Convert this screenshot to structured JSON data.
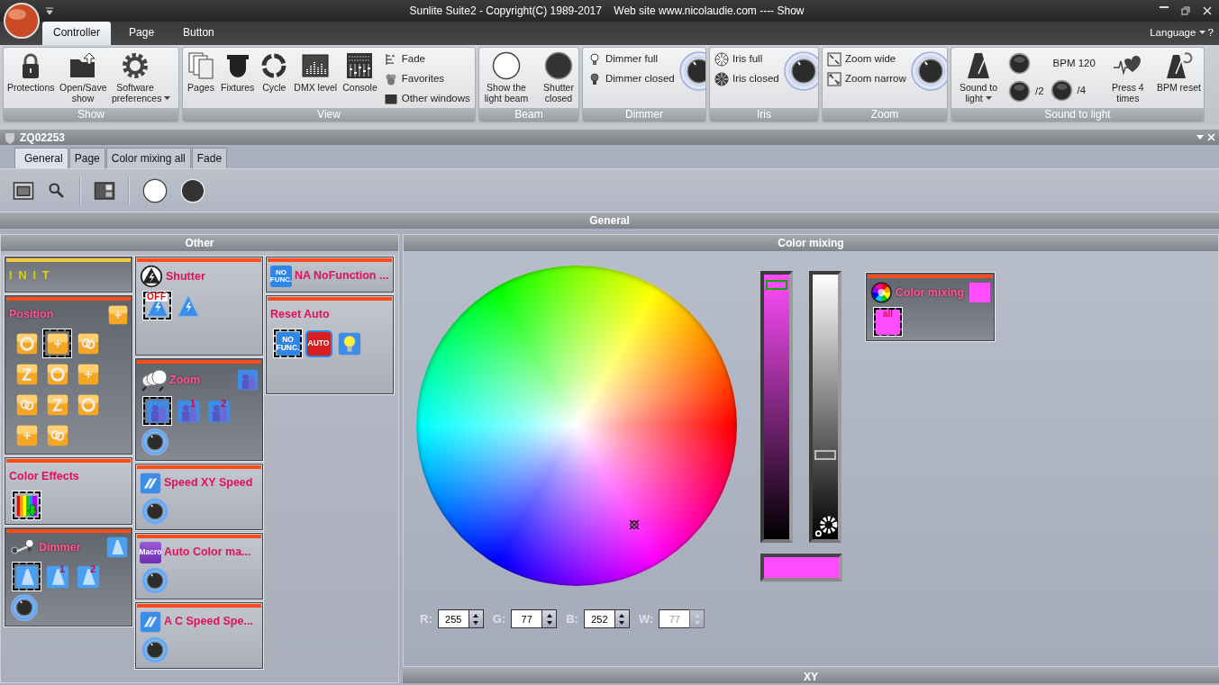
{
  "title_bar": {
    "title": "Sunlite Suite2 - Copyright(C) 1989-2017    Web site www.nicolaudie.com ---- Show"
  },
  "ribbon": {
    "tabs": [
      {
        "label": "Controller",
        "selected": true
      },
      {
        "label": "Page",
        "selected": false
      },
      {
        "label": "Button",
        "selected": false
      }
    ],
    "language": "Language",
    "help": "?",
    "groups": [
      {
        "title": "Show",
        "columns": [
          [
            {
              "kind": "large",
              "label": "Protections"
            }
          ],
          [
            {
              "kind": "large",
              "label": "Open/Save show"
            }
          ],
          [
            {
              "kind": "large",
              "label": "Software preferences",
              "dropdown": true
            }
          ]
        ]
      },
      {
        "title": "View",
        "columns": [
          [
            {
              "kind": "large",
              "label": "Pages"
            }
          ],
          [
            {
              "kind": "large",
              "label": "Fixtures"
            }
          ],
          [
            {
              "kind": "large",
              "label": "Cycle"
            }
          ],
          [
            {
              "kind": "large",
              "label": "DMX level"
            }
          ],
          [
            {
              "kind": "large",
              "label": "Console"
            }
          ],
          [
            {
              "kind": "small",
              "label": "Fade"
            },
            {
              "kind": "small",
              "label": "Favorites"
            },
            {
              "kind": "small",
              "label": "Other windows"
            }
          ]
        ]
      },
      {
        "title": "Beam",
        "columns": [
          [
            {
              "kind": "large",
              "label": "Show the light beam"
            }
          ],
          [
            {
              "kind": "large",
              "label": "Shutter closed"
            }
          ]
        ]
      },
      {
        "title": "Dimmer",
        "columns": [
          [
            {
              "kind": "small",
              "label": "Dimmer full"
            },
            {
              "kind": "small",
              "label": "Dimmer closed"
            }
          ],
          [
            {
              "kind": "knob"
            }
          ]
        ]
      },
      {
        "title": "Iris",
        "columns": [
          [
            {
              "kind": "small",
              "label": "Iris full"
            },
            {
              "kind": "small",
              "label": "Iris closed"
            }
          ],
          [
            {
              "kind": "knob"
            }
          ]
        ]
      },
      {
        "title": "Zoom",
        "columns": [
          [
            {
              "kind": "small",
              "label": "Zoom wide"
            },
            {
              "kind": "small",
              "label": "Zoom narrow"
            }
          ],
          [
            {
              "kind": "knob"
            }
          ]
        ]
      },
      {
        "title": "Sound to light",
        "columns": [
          [
            {
              "kind": "large",
              "label": "Sound to light",
              "dropdown": true
            }
          ],
          [
            {
              "kind": "round"
            },
            {
              "kind": "round",
              "label": "/2"
            }
          ],
          [
            {
              "kind": "text",
              "label": "BPM 120"
            },
            {
              "kind": "round",
              "label": "/4"
            }
          ],
          [
            {
              "kind": "large",
              "label": "Press 4 times"
            }
          ],
          [
            {
              "kind": "large",
              "label": "BPM reset"
            }
          ]
        ]
      }
    ]
  },
  "document": {
    "title": "ZQ02253",
    "tabs": [
      {
        "label": "General",
        "selected": true
      },
      {
        "label": "Page",
        "selected": false
      },
      {
        "label": "Color mixing all",
        "selected": false
      },
      {
        "label": "Fade",
        "selected": false
      }
    ],
    "section": "General",
    "other": {
      "title": "Other",
      "columns": [
        [
          {
            "title": "INIT",
            "kind": "init",
            "color": "#f5c842"
          },
          {
            "title": "Position",
            "kind": "dark",
            "color": "#ff4a1a",
            "corner": {
              "kind": "orange"
            },
            "buttons": [
              {
                "kind": "orange",
                "selected": false
              },
              {
                "kind": "orange",
                "selected": true
              },
              {
                "kind": "orange",
                "selected": false
              },
              {
                "kind": "orange",
                "selected": false
              },
              {
                "kind": "orange",
                "selected": false
              },
              {
                "kind": "orange",
                "selected": false
              },
              {
                "kind": "orange",
                "selected": false
              },
              {
                "kind": "orange",
                "selected": false
              },
              {
                "kind": "orange",
                "selected": false
              },
              {
                "kind": "orange",
                "selected": false
              },
              {
                "kind": "orange",
                "selected": false
              }
            ]
          },
          {
            "title": "Color Effects",
            "kind": "light",
            "color": "#ff4a1a",
            "buttons": [
              {
                "kind": "rainbow",
                "selected": true
              }
            ]
          },
          {
            "title": "Dimmer",
            "kind": "dark",
            "color": "#ff4a1a",
            "lead": {
              "kind": "dimmer"
            },
            "corner": {
              "kind": "beam"
            },
            "buttons": [
              {
                "kind": "beam",
                "selected": true
              },
              {
                "kind": "beam",
                "selected": false,
                "badge": "1"
              },
              {
                "kind": "beam",
                "selected": false,
                "badge": "2"
              }
            ],
            "knob": true
          }
        ],
        [
          {
            "title": "Shutter",
            "kind": "light",
            "color": "#ff4a1a",
            "lead": {
              "kind": "shutter"
            },
            "buttons": [
              {
                "kind": "shutter",
                "selected": true,
                "text": "OFF"
              },
              {
                "kind": "shutter",
                "selected": false
              }
            ]
          },
          {
            "title": "Zoom",
            "kind": "dark",
            "color": "#ff4a1a",
            "lead": {
              "kind": "lens"
            },
            "corner": {
              "kind": "zoom"
            },
            "buttons": [
              {
                "kind": "zoom",
                "selected": true
              },
              {
                "kind": "zoom",
                "selected": false,
                "badge": "1"
              },
              {
                "kind": "zoom",
                "selected": false,
                "badge": "2"
              }
            ],
            "knob": true
          },
          {
            "title": "Speed XY Speed",
            "kind": "light",
            "color": "#ff4a1a",
            "lead": {
              "kind": "speed"
            },
            "knob": true
          },
          {
            "title": "Auto Color ma...",
            "kind": "light",
            "color": "#ff4a1a",
            "lead": {
              "kind": "macro",
              "text": "Macro"
            },
            "knob": true
          },
          {
            "title": "A C Speed Spe...",
            "kind": "light",
            "color": "#ff4a1a",
            "lead": {
              "kind": "speed"
            },
            "knob": true
          }
        ],
        [
          {
            "title": "NA NoFunction ...",
            "kind": "light",
            "color": "#ff4a1a",
            "lead": {
              "kind": "nofunc",
              "text": "NO FUNC."
            }
          },
          {
            "title": "Reset Auto",
            "kind": "light",
            "color": "#ff4a1a",
            "buttons": [
              {
                "kind": "nofunc",
                "selected": true,
                "text": "NO FUNC."
              },
              {
                "kind": "auto",
                "selected": false,
                "text": "AUTO"
              },
              {
                "kind": "bulb",
                "selected": false
              }
            ]
          }
        ]
      ]
    },
    "color_mixing": {
      "title": "Color mixing",
      "sliders": [
        {
          "level": 0.98
        },
        {
          "level": 0.31
        }
      ],
      "fields": [
        {
          "label": "R:",
          "value": "255",
          "disabled": false
        },
        {
          "label": "G:",
          "value": "77",
          "disabled": false
        },
        {
          "label": "B:",
          "value": "252",
          "disabled": false
        },
        {
          "label": "W:",
          "value": "77",
          "disabled": true
        }
      ],
      "card": {
        "title": "Color mixing",
        "kind": "dark",
        "color": "#ff4a1a",
        "lead": {
          "kind": "wheel"
        },
        "corner": {
          "kind": "swatch"
        },
        "buttons": [
          {
            "kind": "swatch",
            "selected": true,
            "text": "all"
          }
        ]
      }
    },
    "xy": {
      "title": "XY"
    }
  }
}
